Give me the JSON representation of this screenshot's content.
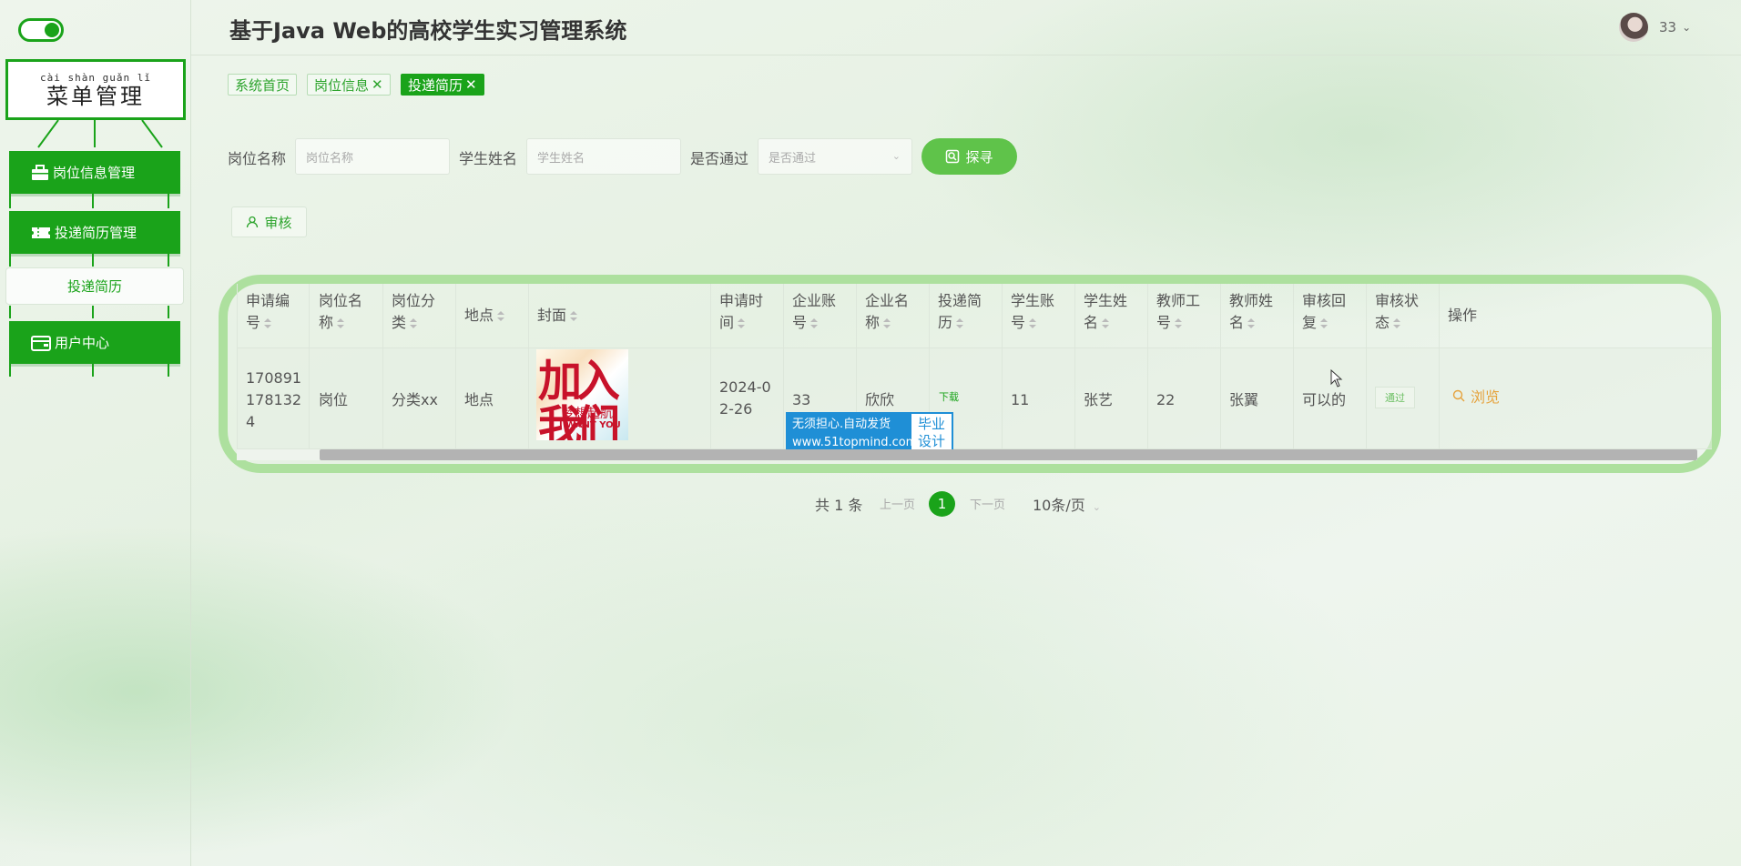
{
  "sidebar": {
    "menu_pinyin": "cài shàn guǎn lǐ",
    "menu_title": "菜单管理",
    "items": [
      {
        "label": "岗位信息管理"
      },
      {
        "label": "投递简历管理"
      },
      {
        "label": "用户中心"
      }
    ],
    "sub_item": "投递简历"
  },
  "header": {
    "title": "基于Java Web的高校学生实习管理系统",
    "user_name": "33"
  },
  "tags": [
    {
      "label": "系统首页"
    },
    {
      "label": "岗位信息"
    },
    {
      "label": "投递简历"
    }
  ],
  "search": {
    "job_label": "岗位名称",
    "job_placeholder": "岗位名称",
    "student_label": "学生姓名",
    "student_placeholder": "学生姓名",
    "pass_label": "是否通过",
    "pass_placeholder": "是否通过",
    "button": "探寻"
  },
  "toolbar": {
    "audit": "审核"
  },
  "table": {
    "headers": [
      "申请编号",
      "岗位名称",
      "岗位分类",
      "地点",
      "封面",
      "申请时间",
      "企业账号",
      "企业名称",
      "投递简历",
      "学生账号",
      "学生姓名",
      "教师工号",
      "教师姓名",
      "审核回复",
      "审核状态",
      "操作"
    ],
    "headers_wrapped": [
      [
        "申请编",
        "号"
      ],
      [
        "岗位名",
        "称"
      ],
      [
        "岗位分",
        "类"
      ],
      [
        "地点"
      ],
      [
        "封面"
      ],
      [
        "申请时",
        "间"
      ],
      [
        "企业账",
        "号"
      ],
      [
        "企业名",
        "称"
      ],
      [
        "投递简",
        "历"
      ],
      [
        "学生账",
        "号"
      ],
      [
        "学生姓",
        "名"
      ],
      [
        "教师工",
        "号"
      ],
      [
        "教师姓",
        "名"
      ],
      [
        "审核回",
        "复"
      ],
      [
        "审核状",
        "态"
      ],
      [
        "操作"
      ]
    ],
    "row": {
      "id_lines": [
        "170891",
        "178132",
        "4"
      ],
      "job": "岗位",
      "category": "分类xx",
      "location": "地点",
      "cover_text": "加入我们",
      "cover_sub": "梦想起航",
      "cover_caption": "I WANT YOU",
      "date_lines": [
        "2024-0",
        "2-26"
      ],
      "company_account": "33",
      "company_name": "欣欣",
      "resume": "下载",
      "student_account": "11",
      "student_name": "张艺",
      "teacher_id": "22",
      "teacher_name": "张翼",
      "reply": "可以的",
      "status": "通过",
      "action": "浏览"
    }
  },
  "watermark": {
    "line1": "无须担心.自动发货",
    "line2": "www.51topmind.com",
    "right1": "毕业",
    "right2": "设计"
  },
  "pagination": {
    "total": "共 1 条",
    "prev": "上一页",
    "current": "1",
    "next": "下一页",
    "page_size": "10条/页"
  },
  "colors": {
    "primary": "#1aa31a",
    "search_button": "#5fc34a",
    "table_frame": "#ade09e",
    "action_link": "#e6a23c",
    "watermark_blue": "#1f8fd6"
  }
}
